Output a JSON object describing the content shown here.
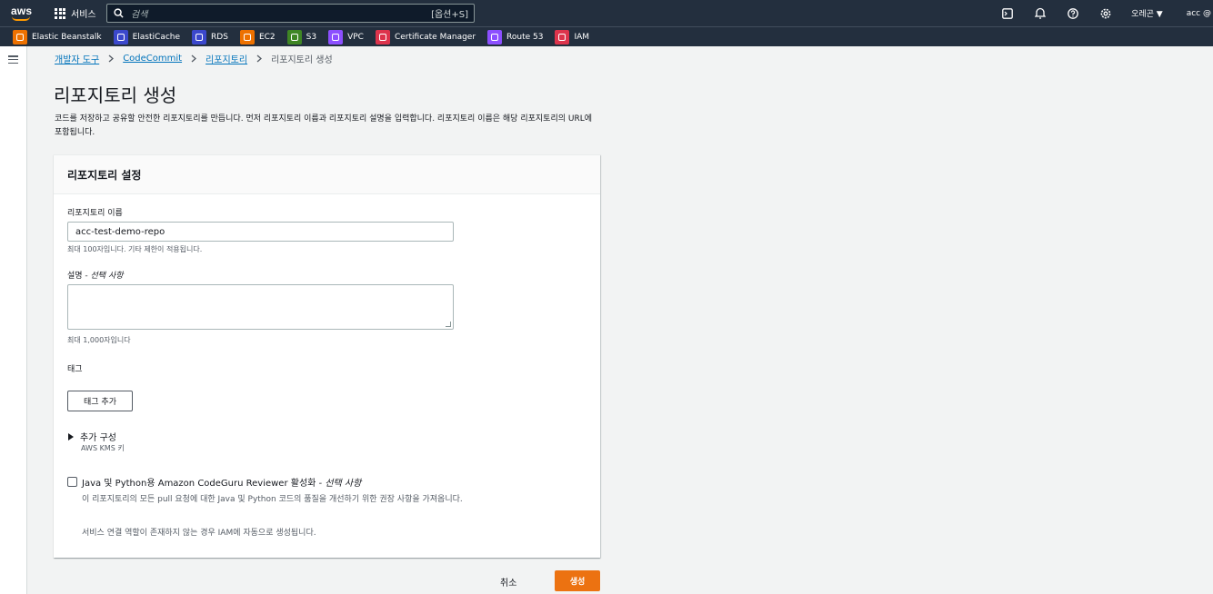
{
  "topbar": {
    "logo_text": "aws",
    "services_label": "서비스",
    "search_placeholder": "검색",
    "search_shortcut": "[옵션+S]",
    "region_label": "오레곤 ▼",
    "account_label": "acc @"
  },
  "favorites": [
    {
      "label": "Elastic Beanstalk",
      "color": "#ed7100"
    },
    {
      "label": "ElastiCache",
      "color": "#3b48cc"
    },
    {
      "label": "RDS",
      "color": "#3b48cc"
    },
    {
      "label": "EC2",
      "color": "#ed7100"
    },
    {
      "label": "S3",
      "color": "#3f8624"
    },
    {
      "label": "VPC",
      "color": "#8c4fff"
    },
    {
      "label": "Certificate Manager",
      "color": "#dd344c"
    },
    {
      "label": "Route 53",
      "color": "#8c4fff"
    },
    {
      "label": "IAM",
      "color": "#dd344c"
    }
  ],
  "breadcrumb": {
    "item1": "개발자 도구",
    "item2": "CodeCommit",
    "item3": "리포지토리",
    "current": "리포지토리 생성"
  },
  "page": {
    "title": "리포지토리 생성",
    "description": "코드를 저장하고 공유할 안전한 리포지토리를 만듭니다. 먼저 리포지토리 이름과 리포지토리 설명을 입력합니다. 리포지토리 이름은 해당 리포지토리의 URL에 포함됩니다."
  },
  "panel": {
    "header": "리포지토리 설정",
    "name_label": "리포지토리 이름",
    "name_value": "acc-test-demo-repo",
    "name_hint": "최대 100자입니다. 기타 제한이 적용됩니다.",
    "desc_label": "설명",
    "desc_optional": " - 선택 사항",
    "desc_hint": "최대 1,000자입니다",
    "tags_label": "태그",
    "add_tag_button": "태그 추가",
    "additional_config": "추가 구성",
    "additional_config_sub": "AWS KMS 키",
    "codeguru_label": "Java 및 Python용 Amazon CodeGuru Reviewer 활성화",
    "codeguru_optional": " - 선택 사항",
    "codeguru_desc": "이 리포지토리의 모든 pull 요청에 대한 Java 및 Python 코드의 품질을 개선하기 위한 권장 사항을 가져옵니다.",
    "codeguru_desc2": "서비스 연결 역할이 존재하지 않는 경우 IAM에 자동으로 생성됩니다."
  },
  "footer": {
    "cancel": "취소",
    "create": "생성"
  },
  "colors": {
    "nav_bg": "#232f3e",
    "primary_button": "#ec7211",
    "link": "#0073bb"
  }
}
